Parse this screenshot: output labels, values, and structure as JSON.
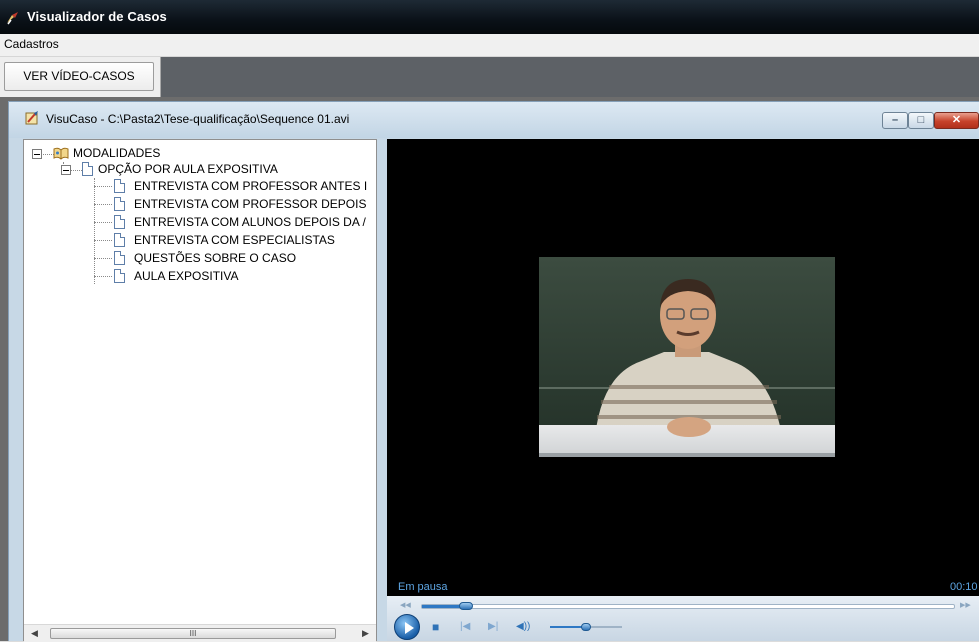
{
  "app": {
    "title": "Visualizador de Casos"
  },
  "menu": {
    "items": [
      "Cadastros"
    ]
  },
  "toolbar": {
    "button_label": "VER VÍDEO-CASOS"
  },
  "child_window": {
    "title": "VisuCaso - C:\\Pasta2\\Tese-qualificação\\Sequence 01.avi",
    "buttons": {
      "minimize": "–",
      "maximize": "□",
      "close": "✕"
    }
  },
  "tree": {
    "root": "MODALIDADES",
    "node": "OPÇÃO POR AULA EXPOSITIVA",
    "children": [
      "ENTREVISTA COM PROFESSOR ANTES I",
      "ENTREVISTA COM PROFESSOR DEPOIS",
      "ENTREVISTA COM ALUNOS DEPOIS DA /",
      "ENTREVISTA COM ESPECIALISTAS",
      "QUESTÕES SOBRE O CASO",
      "AULA EXPOSITIVA"
    ],
    "scroll": {
      "left_arrow": "◀",
      "right_arrow": "▶",
      "thumb_grip": "III"
    }
  },
  "player": {
    "status": "Em pausa",
    "time": "00:10",
    "seek_progress": 0.07,
    "volume": 0.5,
    "controls": {
      "stop": "■",
      "previous": "|◀",
      "next": "▶|",
      "volume": "◀))"
    }
  },
  "colors": {
    "titlebar": "#0a1118",
    "accent": "#2e78c4",
    "status_text": "#5ea5e2"
  }
}
